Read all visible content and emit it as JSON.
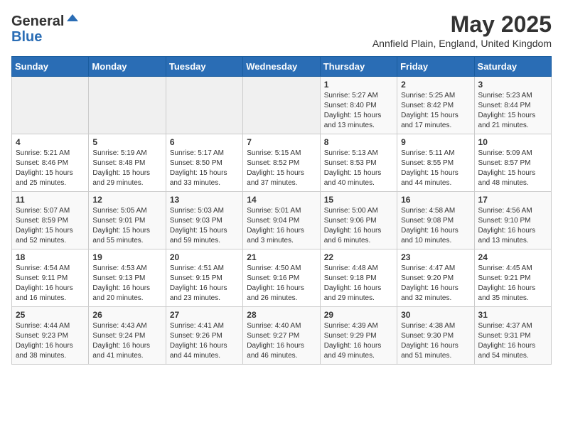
{
  "header": {
    "logo_general": "General",
    "logo_blue": "Blue",
    "month_title": "May 2025",
    "subtitle": "Annfield Plain, England, United Kingdom"
  },
  "days_of_week": [
    "Sunday",
    "Monday",
    "Tuesday",
    "Wednesday",
    "Thursday",
    "Friday",
    "Saturday"
  ],
  "weeks": [
    [
      {
        "day": "",
        "sunrise": "",
        "sunset": "",
        "daylight": ""
      },
      {
        "day": "",
        "sunrise": "",
        "sunset": "",
        "daylight": ""
      },
      {
        "day": "",
        "sunrise": "",
        "sunset": "",
        "daylight": ""
      },
      {
        "day": "",
        "sunrise": "",
        "sunset": "",
        "daylight": ""
      },
      {
        "day": "1",
        "sunrise": "5:27 AM",
        "sunset": "8:40 PM",
        "daylight": "15 hours and 13 minutes."
      },
      {
        "day": "2",
        "sunrise": "5:25 AM",
        "sunset": "8:42 PM",
        "daylight": "15 hours and 17 minutes."
      },
      {
        "day": "3",
        "sunrise": "5:23 AM",
        "sunset": "8:44 PM",
        "daylight": "15 hours and 21 minutes."
      }
    ],
    [
      {
        "day": "4",
        "sunrise": "5:21 AM",
        "sunset": "8:46 PM",
        "daylight": "15 hours and 25 minutes."
      },
      {
        "day": "5",
        "sunrise": "5:19 AM",
        "sunset": "8:48 PM",
        "daylight": "15 hours and 29 minutes."
      },
      {
        "day": "6",
        "sunrise": "5:17 AM",
        "sunset": "8:50 PM",
        "daylight": "15 hours and 33 minutes."
      },
      {
        "day": "7",
        "sunrise": "5:15 AM",
        "sunset": "8:52 PM",
        "daylight": "15 hours and 37 minutes."
      },
      {
        "day": "8",
        "sunrise": "5:13 AM",
        "sunset": "8:53 PM",
        "daylight": "15 hours and 40 minutes."
      },
      {
        "day": "9",
        "sunrise": "5:11 AM",
        "sunset": "8:55 PM",
        "daylight": "15 hours and 44 minutes."
      },
      {
        "day": "10",
        "sunrise": "5:09 AM",
        "sunset": "8:57 PM",
        "daylight": "15 hours and 48 minutes."
      }
    ],
    [
      {
        "day": "11",
        "sunrise": "5:07 AM",
        "sunset": "8:59 PM",
        "daylight": "15 hours and 52 minutes."
      },
      {
        "day": "12",
        "sunrise": "5:05 AM",
        "sunset": "9:01 PM",
        "daylight": "15 hours and 55 minutes."
      },
      {
        "day": "13",
        "sunrise": "5:03 AM",
        "sunset": "9:03 PM",
        "daylight": "15 hours and 59 minutes."
      },
      {
        "day": "14",
        "sunrise": "5:01 AM",
        "sunset": "9:04 PM",
        "daylight": "16 hours and 3 minutes."
      },
      {
        "day": "15",
        "sunrise": "5:00 AM",
        "sunset": "9:06 PM",
        "daylight": "16 hours and 6 minutes."
      },
      {
        "day": "16",
        "sunrise": "4:58 AM",
        "sunset": "9:08 PM",
        "daylight": "16 hours and 10 minutes."
      },
      {
        "day": "17",
        "sunrise": "4:56 AM",
        "sunset": "9:10 PM",
        "daylight": "16 hours and 13 minutes."
      }
    ],
    [
      {
        "day": "18",
        "sunrise": "4:54 AM",
        "sunset": "9:11 PM",
        "daylight": "16 hours and 16 minutes."
      },
      {
        "day": "19",
        "sunrise": "4:53 AM",
        "sunset": "9:13 PM",
        "daylight": "16 hours and 20 minutes."
      },
      {
        "day": "20",
        "sunrise": "4:51 AM",
        "sunset": "9:15 PM",
        "daylight": "16 hours and 23 minutes."
      },
      {
        "day": "21",
        "sunrise": "4:50 AM",
        "sunset": "9:16 PM",
        "daylight": "16 hours and 26 minutes."
      },
      {
        "day": "22",
        "sunrise": "4:48 AM",
        "sunset": "9:18 PM",
        "daylight": "16 hours and 29 minutes."
      },
      {
        "day": "23",
        "sunrise": "4:47 AM",
        "sunset": "9:20 PM",
        "daylight": "16 hours and 32 minutes."
      },
      {
        "day": "24",
        "sunrise": "4:45 AM",
        "sunset": "9:21 PM",
        "daylight": "16 hours and 35 minutes."
      }
    ],
    [
      {
        "day": "25",
        "sunrise": "4:44 AM",
        "sunset": "9:23 PM",
        "daylight": "16 hours and 38 minutes."
      },
      {
        "day": "26",
        "sunrise": "4:43 AM",
        "sunset": "9:24 PM",
        "daylight": "16 hours and 41 minutes."
      },
      {
        "day": "27",
        "sunrise": "4:41 AM",
        "sunset": "9:26 PM",
        "daylight": "16 hours and 44 minutes."
      },
      {
        "day": "28",
        "sunrise": "4:40 AM",
        "sunset": "9:27 PM",
        "daylight": "16 hours and 46 minutes."
      },
      {
        "day": "29",
        "sunrise": "4:39 AM",
        "sunset": "9:29 PM",
        "daylight": "16 hours and 49 minutes."
      },
      {
        "day": "30",
        "sunrise": "4:38 AM",
        "sunset": "9:30 PM",
        "daylight": "16 hours and 51 minutes."
      },
      {
        "day": "31",
        "sunrise": "4:37 AM",
        "sunset": "9:31 PM",
        "daylight": "16 hours and 54 minutes."
      }
    ]
  ]
}
